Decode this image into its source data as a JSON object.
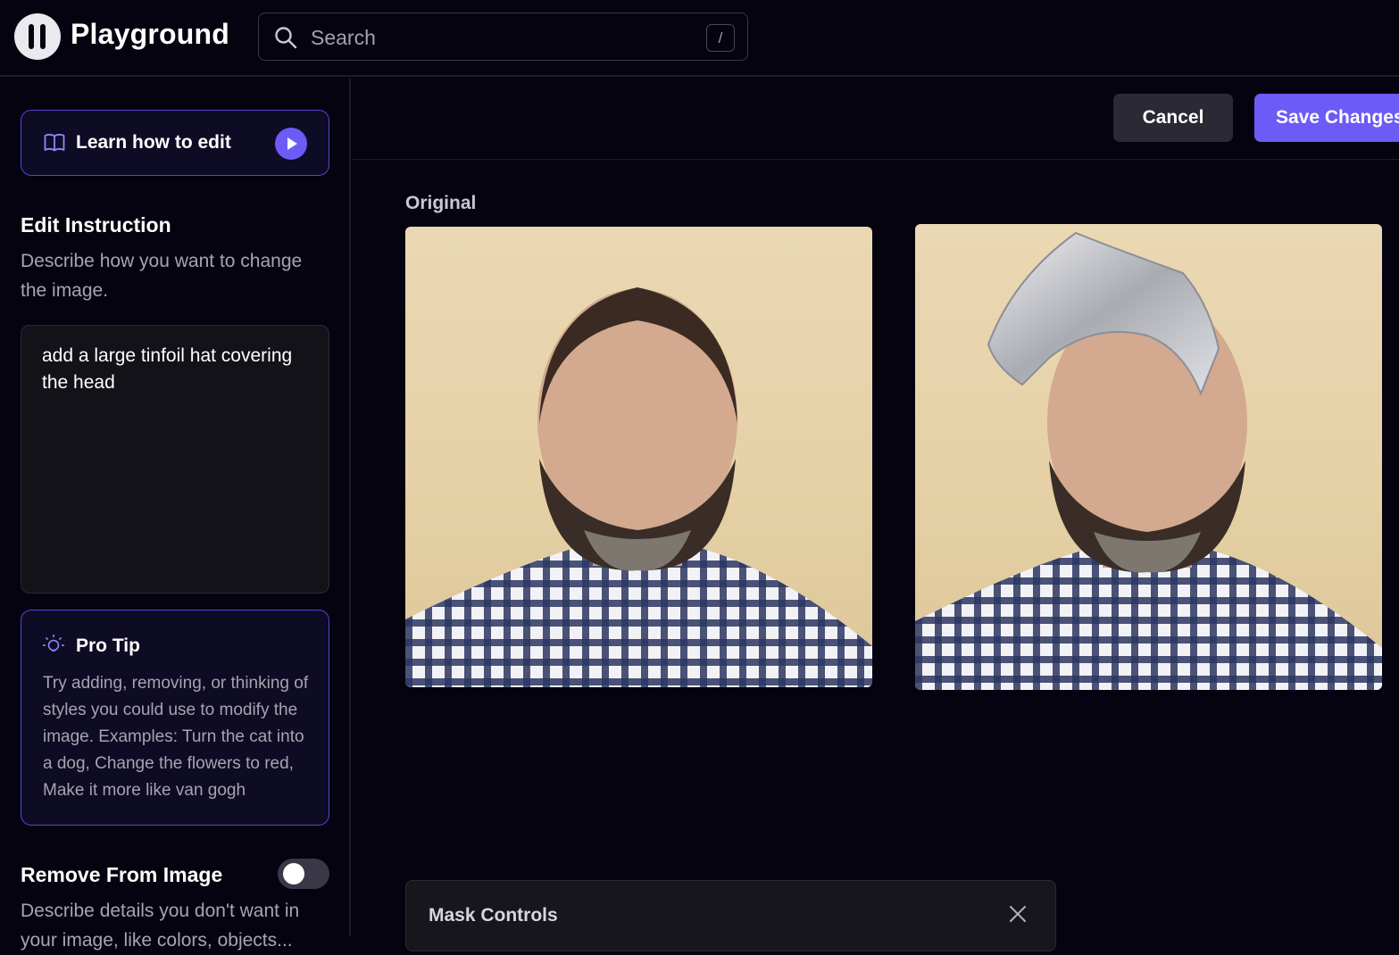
{
  "app": {
    "name": "Playground"
  },
  "search": {
    "placeholder": "Search",
    "shortcut": "/"
  },
  "sidebar": {
    "learn_label": "Learn how to edit",
    "edit_instruction": {
      "title": "Edit Instruction",
      "description": "Describe how you want to change the image.",
      "value": "add a large tinfoil hat covering the head"
    },
    "pro_tip": {
      "title": "Pro Tip",
      "body": "Try adding, removing, or thinking of styles you could use to modify the image. Examples: Turn the cat into a dog, Change the flowers to red, Make it more like van gogh"
    },
    "remove": {
      "title": "Remove From Image",
      "enabled": false,
      "description": "Describe details you don't want in your image, like colors, objects..."
    }
  },
  "actions": {
    "cancel_label": "Cancel",
    "save_label": "Save Changes"
  },
  "main": {
    "original_label": "Original",
    "mask_controls_title": "Mask Controls"
  },
  "colors": {
    "background": "#05030f",
    "accent": "#6c5bf6",
    "card_border": "#5146d8",
    "muted_text": "#a6a4b0"
  },
  "icons": {
    "logo": "playground-logo-icon",
    "search": "search-icon",
    "learn": "book-open-icon",
    "play": "play-icon",
    "tip": "lightbulb-icon",
    "close": "close-icon"
  }
}
